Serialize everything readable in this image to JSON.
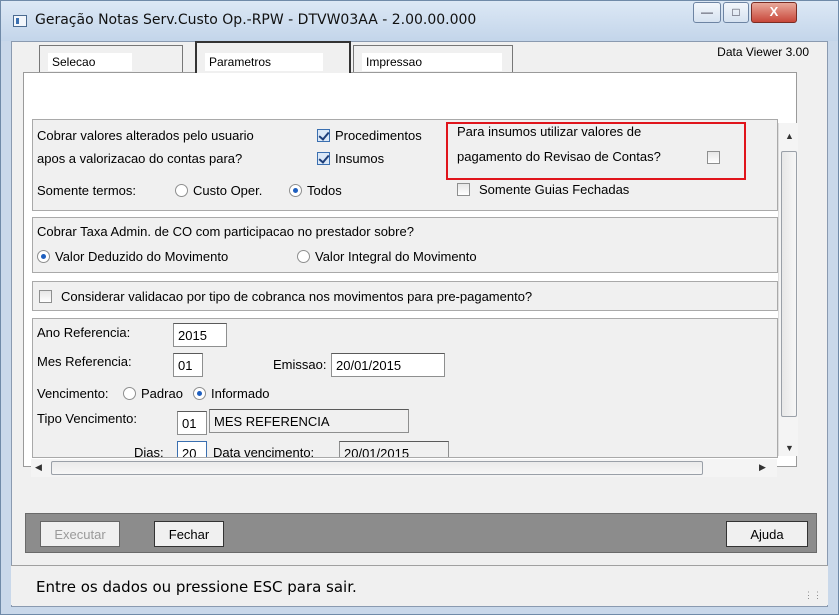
{
  "window": {
    "title": "Geração Notas Serv.Custo Op.-RPW - DTVW03AA - 2.00.00.000",
    "btn_min": "—",
    "btn_max": "□",
    "btn_close": "X"
  },
  "tabs": [
    {
      "label": "Selecao"
    },
    {
      "label": "Parametros"
    },
    {
      "label": "Impressao"
    }
  ],
  "viewer_version": "Data Viewer 3.00",
  "group1": {
    "question_line1": "Cobrar valores alterados pelo usuario",
    "question_line2": "apos a valorizacao do contas para?",
    "procedimentos": "Procedimentos",
    "insumos": "Insumos",
    "insumos_line1": "Para insumos utilizar valores de",
    "insumos_line2": "pagamento do Revisao de Contas?",
    "somente_termos": "Somente termos:",
    "custo_oper": "Custo Oper.",
    "todos": "Todos",
    "guias_fechadas": "Somente Guias Fechadas"
  },
  "group2": {
    "question": "Cobrar Taxa Admin. de CO com participacao no prestador sobre?",
    "opt_deduzido": "Valor Deduzido do Movimento",
    "opt_integral": "Valor Integral do Movimento"
  },
  "group3": {
    "label": "Considerar validacao por tipo de cobranca nos movimentos para pre-pagamento?"
  },
  "group4": {
    "ano_label": "Ano Referencia:",
    "ano_value": "2015",
    "mes_label": "Mes Referencia:",
    "mes_value": "01",
    "emissao_label": "Emissao:",
    "emissao_value": "20/01/2015",
    "vencimento_label": "Vencimento:",
    "padrao": "Padrao",
    "informado": "Informado",
    "tipo_label": "Tipo Vencimento:",
    "tipo_code": "01",
    "tipo_desc": "MES REFERENCIA",
    "dias_label": "Dias:",
    "dias_value": "20",
    "data_venc_label": "Data vencimento:",
    "data_venc_value": "20/01/2015"
  },
  "buttons": {
    "executar": "Executar",
    "fechar": "Fechar",
    "ajuda": "Ajuda"
  },
  "status_text": "Entre os dados ou pressione ESC para sair."
}
